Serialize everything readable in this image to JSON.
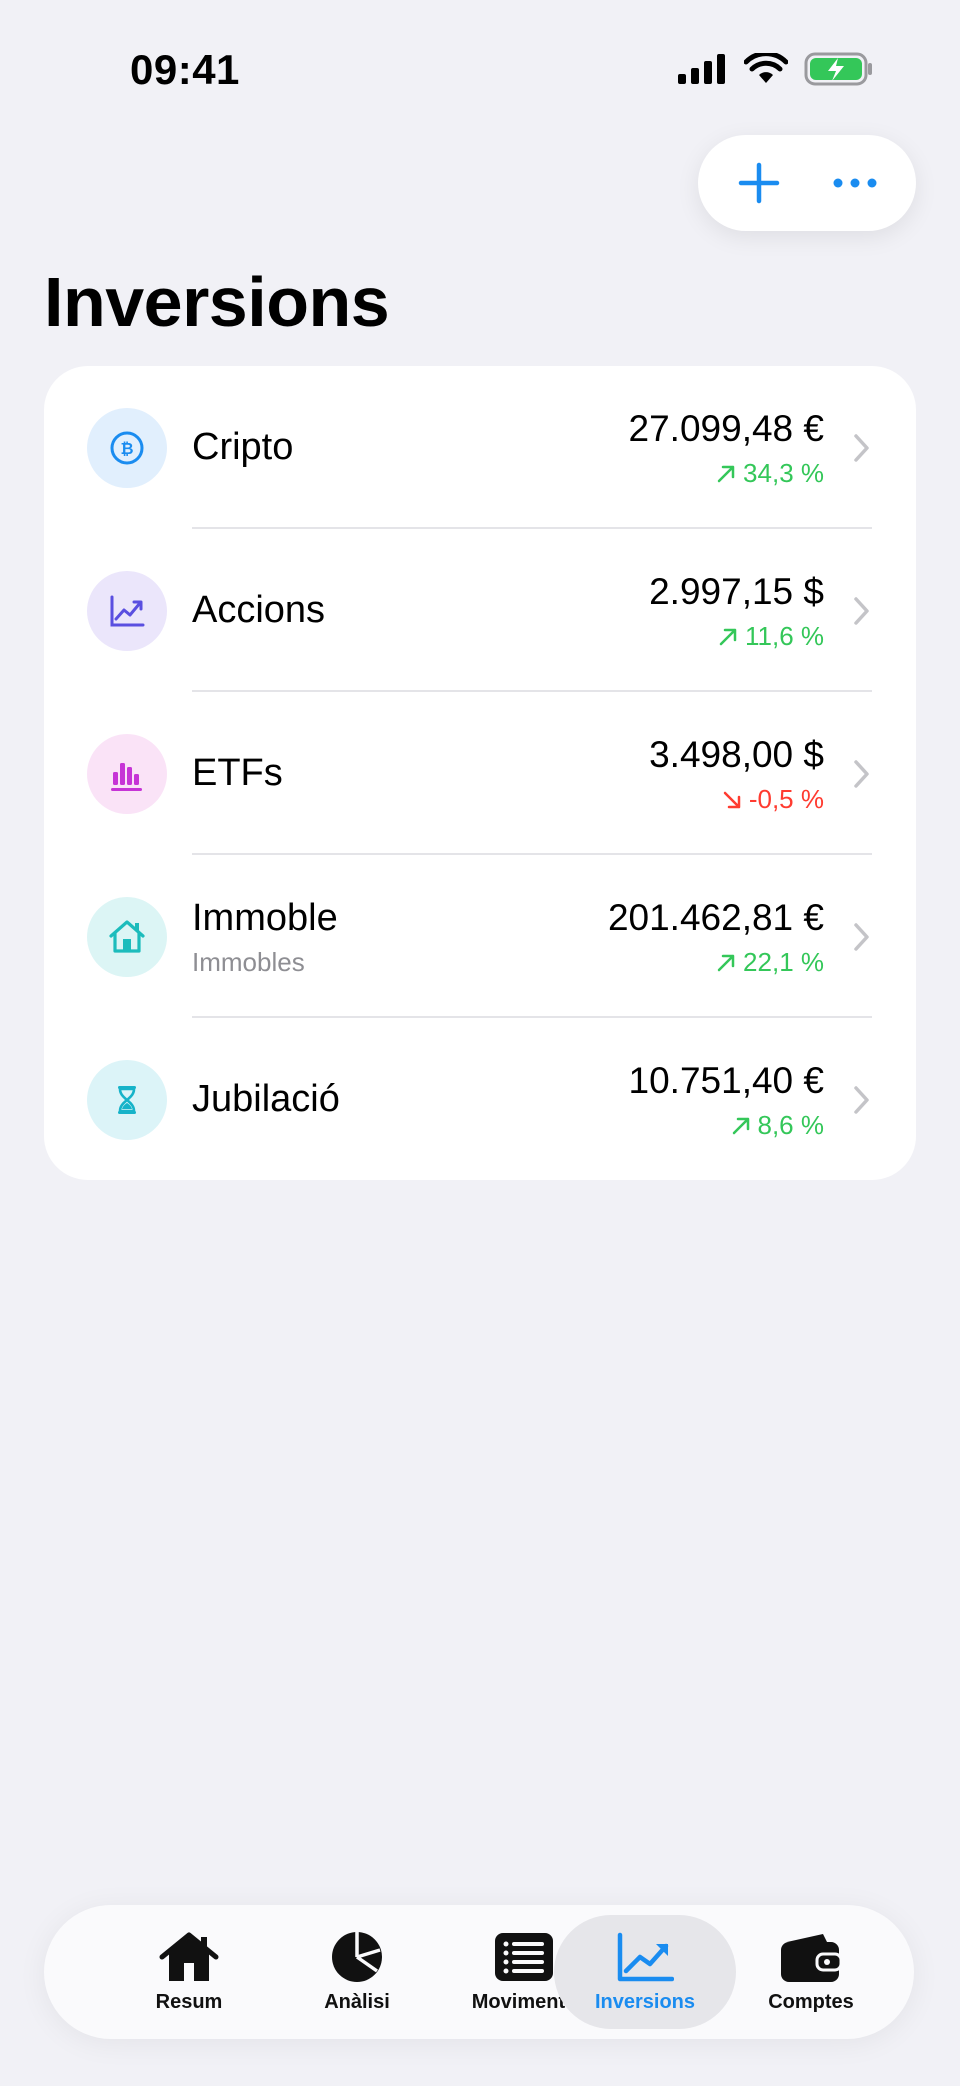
{
  "status": {
    "time": "09:41"
  },
  "page": {
    "title": "Inversions"
  },
  "accounts": [
    {
      "name": "Cripto",
      "subtitle": "",
      "value": "27.099,48 €",
      "change": "34,3 %",
      "direction": "up",
      "icon": "bitcoin-icon",
      "icon_bg": "#e1effd",
      "icon_color": "#1a8cf0"
    },
    {
      "name": "Accions",
      "subtitle": "",
      "value": "2.997,15 $",
      "change": "11,6 %",
      "direction": "up",
      "icon": "line-chart-icon",
      "icon_bg": "#ebe6fb",
      "icon_color": "#5a4fe0"
    },
    {
      "name": "ETFs",
      "subtitle": "",
      "value": "3.498,00 $",
      "change": "-0,5 %",
      "direction": "down",
      "icon": "bar-chart-icon",
      "icon_bg": "#fae3f7",
      "icon_color": "#c634d6"
    },
    {
      "name": "Immoble",
      "subtitle": "Immobles",
      "value": "201.462,81 €",
      "change": "22,1 %",
      "direction": "up",
      "icon": "house-icon",
      "icon_bg": "#dcf5f5",
      "icon_color": "#1cbcbc"
    },
    {
      "name": "Jubilació",
      "subtitle": "",
      "value": "10.751,40 €",
      "change": "8,6 %",
      "direction": "up",
      "icon": "hourglass-icon",
      "icon_bg": "#dcf4f8",
      "icon_color": "#17b3c9"
    }
  ],
  "tabs": [
    {
      "label": "Resum",
      "icon": "house-icon",
      "active": false
    },
    {
      "label": "Anàlisi",
      "icon": "pie-chart-icon",
      "active": false
    },
    {
      "label": "Moviments",
      "icon": "list-icon",
      "active": false
    },
    {
      "label": "Inversions",
      "icon": "trend-chart-icon",
      "active": true
    },
    {
      "label": "Comptes",
      "icon": "wallet-icon",
      "active": false
    }
  ],
  "colors": {
    "accent": "#1a8cf0",
    "positive": "#34c759",
    "negative": "#ff3b30",
    "background": "#f1f1f6"
  }
}
